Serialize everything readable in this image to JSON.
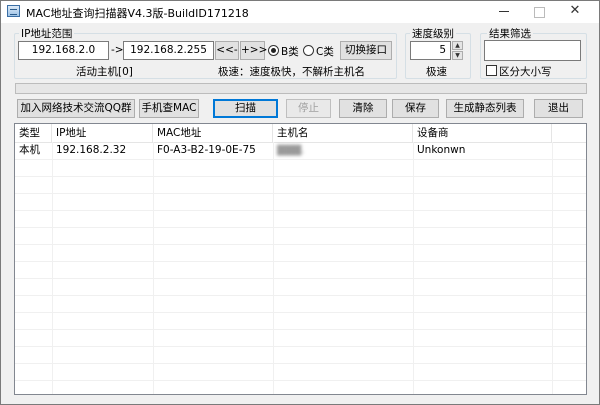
{
  "window": {
    "title": "MAC地址查询扫描器V4.3版-BuildID171218",
    "controls": {
      "minimize": "—",
      "maximize": "☐",
      "close": "✕"
    }
  },
  "ip_range": {
    "group_label": "IP地址范围",
    "start_ip": "192.168.2.0",
    "arrow": "->",
    "end_ip": "192.168.2.255",
    "prev_btn": "<<-",
    "next_btn": "+>>",
    "class_b": "B类",
    "class_c": "C类",
    "class_selected": "B",
    "switch_btn": "切换接口",
    "active_hosts": "活动主机[0]",
    "speed_status": "极速：速度极快，不解析主机名"
  },
  "speed": {
    "group_label": "速度级别",
    "value": "5",
    "label": "极速"
  },
  "filter": {
    "group_label": "结果筛选",
    "value": "",
    "case_label": "区分大小写",
    "case_checked": false
  },
  "progress": {
    "value": 0
  },
  "toolbar": {
    "join_group": "加入网络技术交流QQ群",
    "phone_mac": "手机查MAC",
    "scan": "扫描",
    "stop": "停止",
    "clear": "清除",
    "save": "保存",
    "gen_static": "生成静态列表",
    "exit": "退出"
  },
  "table": {
    "columns": [
      "类型",
      "IP地址",
      "MAC地址",
      "主机名",
      "设备商"
    ],
    "rows": [
      {
        "type": "本机",
        "ip": "192.168.2.32",
        "mac": "F0-A3-B2-19-0E-75",
        "host": "",
        "vendor": "Unkonwn"
      }
    ]
  }
}
